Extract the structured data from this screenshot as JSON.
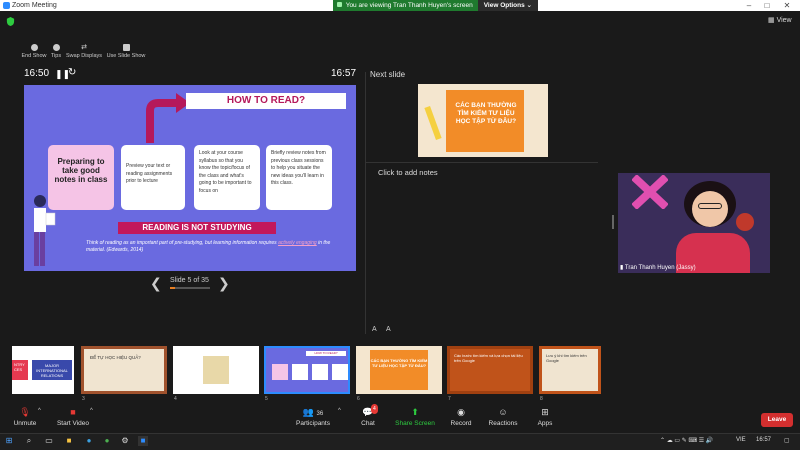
{
  "window": {
    "title": "Zoom Meeting",
    "minimize": "–",
    "maximize": "□",
    "close": "✕"
  },
  "banner": {
    "text": "You are viewing Tran Thanh Huyen's screen",
    "options": "View Options ⌄"
  },
  "view_label": "View",
  "presenter_tools": [
    {
      "label": "End Show"
    },
    {
      "label": "Tips"
    },
    {
      "label": "Swap Displays"
    },
    {
      "label": "Use Slide Show"
    }
  ],
  "timer": {
    "elapsed": "16:50",
    "clock": "16:57"
  },
  "slide": {
    "title": "HOW TO READ?",
    "card1": "Preparing to take good notes in class",
    "card2": "Preview your text or reading assignments prior to lecture",
    "card3": "Look at your course syllabus so that you know the topic/focus of the class and what's going to be important to focus on",
    "card4": "Briefly review notes from previous class sessions to help you situate the new ideas you'll learn in this class.",
    "banner": "READING IS NOT STUDYING",
    "quote_a": "Think of reading as an important part of pre-studying, but learning information requires ",
    "quote_link": "actively engaging",
    "quote_b": " in the material. (Edwards, 2014)"
  },
  "slide_nav": {
    "label": "Slide 5 of 35",
    "prev": "❮",
    "next": "❯"
  },
  "next_slide": {
    "label": "Next slide",
    "text": "CÁC BẠN THƯỜNG TÌM KIẾM TƯ LIỆU HỌC TẬP TỪ ĐÂU?"
  },
  "notes_placeholder": "Click to add notes",
  "font_buttons": [
    "A",
    "A"
  ],
  "video": {
    "name": "Tran Thanh Huyen (Jassy)"
  },
  "thumbnails": [
    {
      "num": "",
      "t1": "MAJOR INTERNATIONAL RELATIONS",
      "t2": "NTRY CES"
    },
    {
      "num": "3",
      "t1": "ĐỂ TỰ HỌC HIỆU QUẢ?"
    },
    {
      "num": "4",
      "t1": ""
    },
    {
      "num": "5",
      "t1": "HOW TO READ?"
    },
    {
      "num": "6",
      "t1": "CÁC BẠN THƯỜNG TÌM KIẾM TƯ LIỆU HỌC TẬP TỪ ĐÂU?"
    },
    {
      "num": "7",
      "t1": "Các bước tìm kiếm và lựa chọn tài liệu trên Google"
    },
    {
      "num": "8",
      "t1": "Lưu ý khi tìm kiếm trên Google"
    }
  ],
  "bottom_bar": {
    "unmute": "Unmute",
    "start_video": "Start Video",
    "participants": "Participants",
    "participants_count": "36",
    "chat": "Chat",
    "chat_badge": "4",
    "share": "Share Screen",
    "record": "Record",
    "reactions": "Reactions",
    "apps": "Apps",
    "leave": "Leave"
  },
  "taskbar": {
    "lang": "VIE",
    "time": "16:57"
  },
  "colors": {
    "slide_bg": "#6a6ae0",
    "accent_pink": "#c2185b",
    "share_green": "#2ecc40",
    "leave_red": "#d32f2f",
    "banner_green": "#1f7a2e"
  }
}
